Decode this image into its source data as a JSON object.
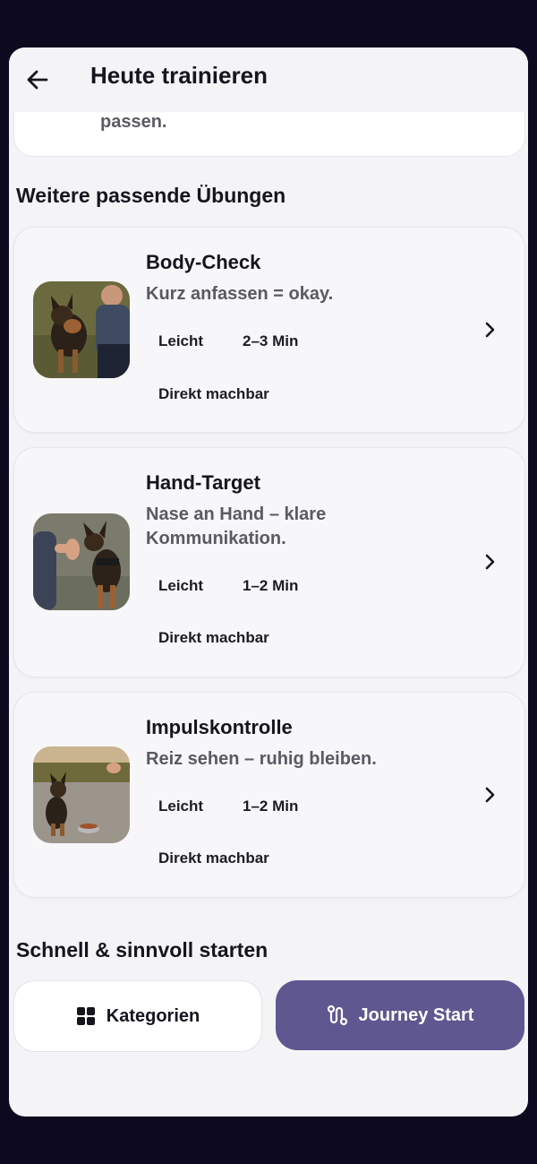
{
  "header": {
    "title": "Heute trainieren"
  },
  "previous_card": {
    "text_tail": "passen."
  },
  "sections": {
    "more_exercises": "Weitere passende Übungen",
    "quick_start": "Schnell & sinnvoll starten"
  },
  "exercises": [
    {
      "title": "Body-Check",
      "subtitle": "Kurz anfassen = okay.",
      "level": "Leicht",
      "duration": "2–3 Min",
      "availability": "Direkt machbar",
      "image_icon": "dog-with-trainer-photo"
    },
    {
      "title": "Hand-Target",
      "subtitle": "Nase an Hand – klare Kommunikation.",
      "level": "Leicht",
      "duration": "1–2 Min",
      "availability": "Direkt machbar",
      "image_icon": "dog-hand-target-photo"
    },
    {
      "title": "Impulskontrolle",
      "subtitle": "Reiz sehen – ruhig bleiben.",
      "level": "Leicht",
      "duration": "1–2 Min",
      "availability": "Direkt machbar",
      "image_icon": "dog-sitting-food-bowl-photo"
    }
  ],
  "actions": {
    "categories_label": "Kategorien",
    "journey_label": "Journey Start"
  },
  "colors": {
    "accent": "#5f5790",
    "background": "#0d0a1f",
    "sheet": "#f4f3f6"
  }
}
